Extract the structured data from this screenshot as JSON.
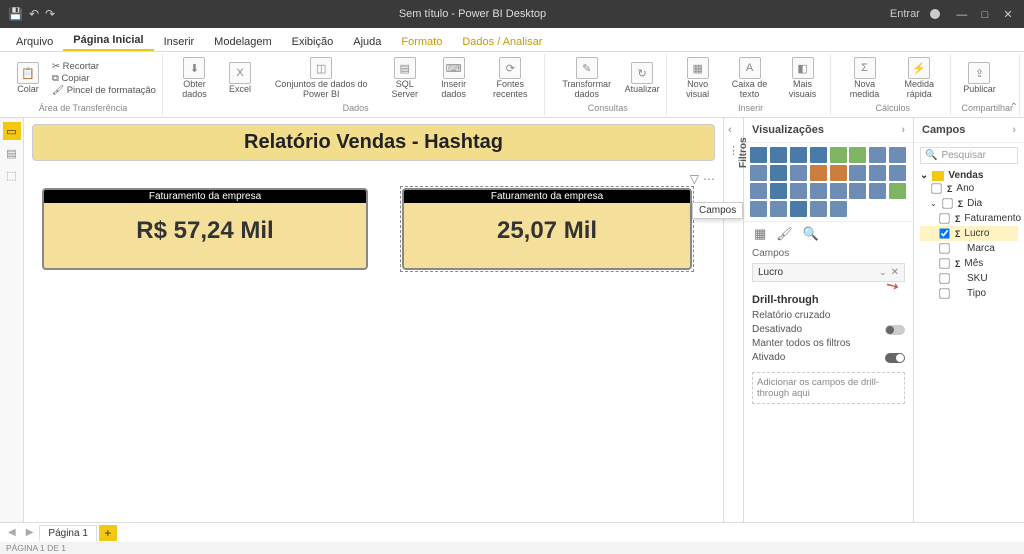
{
  "title": "Sem título - Power BI Desktop",
  "titlebar": {
    "signin": "Entrar",
    "save": "💾",
    "undo": "↶",
    "redo": "↷"
  },
  "tabs": [
    "Arquivo",
    "Página Inicial",
    "Inserir",
    "Modelagem",
    "Exibição",
    "Ajuda",
    "Formato",
    "Dados / Analisar"
  ],
  "activeTab": 1,
  "ribbon": {
    "clipboard": {
      "paste": "Colar",
      "cut": "Recortar",
      "copy": "Copiar",
      "format": "Pincel de formatação",
      "label": "Área de Transferência"
    },
    "data": {
      "get": "Obter dados",
      "excel": "Excel",
      "pbi": "Conjuntos de dados do Power BI",
      "sql": "SQL Server",
      "enter": "Inserir dados",
      "recent": "Fontes recentes",
      "label": "Dados"
    },
    "queries": {
      "transform": "Transformar dados",
      "refresh": "Atualizar",
      "label": "Consultas"
    },
    "insert": {
      "visual": "Novo visual",
      "textbox": "Caixa de texto",
      "more": "Mais visuais",
      "label": "Inserir"
    },
    "calc": {
      "measure": "Nova medida",
      "quick": "Medida rápida",
      "label": "Cálculos"
    },
    "share": {
      "publish": "Publicar",
      "label": "Compartilhar"
    }
  },
  "report": {
    "pageTitle": "Relatório Vendas - Hashtag",
    "card1": {
      "header": "Faturamento da empresa",
      "value": "R$ 57,24 Mil"
    },
    "card2": {
      "header": "Faturamento da empresa",
      "value": "25,07 Mil"
    }
  },
  "filtersLabel": "Filtros",
  "camposTooltip": "Campos",
  "visPane": {
    "title": "Visualizações",
    "fieldsLabel": "Campos",
    "fieldWell": "Lucro",
    "drillTitle": "Drill-through",
    "crossLabel": "Relatório cruzado",
    "crossState": "Desativado",
    "keepLabel": "Manter todos os filtros",
    "keepState": "Ativado",
    "dropHint": "Adicionar os campos de drill-through aqui"
  },
  "fieldsPane": {
    "title": "Campos",
    "search": "Pesquisar",
    "table": "Vendas",
    "fields": [
      {
        "name": "Ano",
        "sigma": true,
        "checked": false
      },
      {
        "name": "Dia",
        "sigma": true,
        "checked": false,
        "expanded": true
      },
      {
        "name": "Faturamento",
        "sigma": true,
        "checked": false,
        "indent": true
      },
      {
        "name": "Lucro",
        "sigma": true,
        "checked": true,
        "indent": true,
        "hl": true
      },
      {
        "name": "Marca",
        "sigma": false,
        "checked": false,
        "indent": true
      },
      {
        "name": "Mês",
        "sigma": true,
        "checked": false,
        "indent": true
      },
      {
        "name": "SKU",
        "sigma": false,
        "checked": false,
        "indent": true
      },
      {
        "name": "Tipo",
        "sigma": false,
        "checked": false,
        "indent": true
      }
    ]
  },
  "pageTab": "Página 1",
  "status": "PÁGINA 1 DE 1"
}
